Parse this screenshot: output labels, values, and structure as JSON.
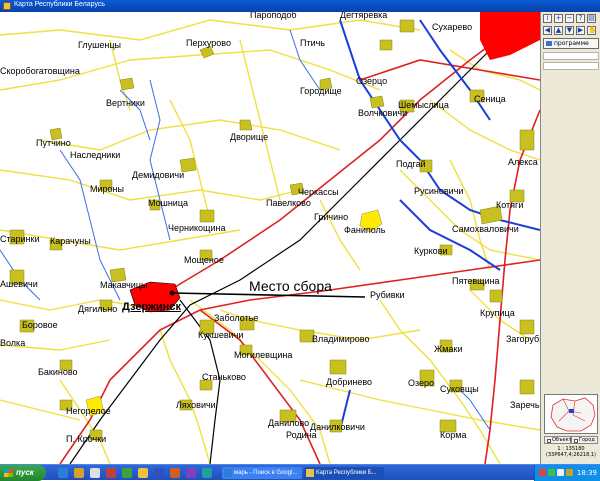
{
  "window": {
    "title": "Карта Республики Беларусь"
  },
  "map": {
    "places": [
      {
        "name": "Пароподоб",
        "key": "p1"
      },
      {
        "name": "Дегтяревка",
        "key": "p2"
      },
      {
        "name": "Сухарево",
        "key": "p3"
      },
      {
        "name": "Глушенцы",
        "key": "p4"
      },
      {
        "name": "Перхурово",
        "key": "p5"
      },
      {
        "name": "Птичь",
        "key": "p6"
      },
      {
        "name": "Скоробогатовщина",
        "key": "p7"
      },
      {
        "name": "Озерцо",
        "key": "p8"
      },
      {
        "name": "Городище",
        "key": "p9"
      },
      {
        "name": "Вертники",
        "key": "p10"
      },
      {
        "name": "Шемыслица",
        "key": "p11"
      },
      {
        "name": "Сеница",
        "key": "p12"
      },
      {
        "name": "Волчковичи",
        "key": "p13"
      },
      {
        "name": "Дворище",
        "key": "p14"
      },
      {
        "name": "Путчино",
        "key": "p15"
      },
      {
        "name": "Наследники",
        "key": "p16"
      },
      {
        "name": "Подгай",
        "key": "p17"
      },
      {
        "name": "Алекса",
        "key": "p18"
      },
      {
        "name": "Демидовичи",
        "key": "p19"
      },
      {
        "name": "Мироны",
        "key": "p20"
      },
      {
        "name": "Черкассы",
        "key": "p21"
      },
      {
        "name": "Русиновичи",
        "key": "p22"
      },
      {
        "name": "Мошница",
        "key": "p23"
      },
      {
        "name": "Павелково",
        "key": "p24"
      },
      {
        "name": "Котяги",
        "key": "p25"
      },
      {
        "name": "Гричино",
        "key": "p26"
      },
      {
        "name": "Черникощина",
        "key": "p27"
      },
      {
        "name": "Фаниполь",
        "key": "p28"
      },
      {
        "name": "Самохваловичи",
        "key": "p29"
      },
      {
        "name": "Старинки",
        "key": "p30"
      },
      {
        "name": "Карачуны",
        "key": "p31"
      },
      {
        "name": "Куркови",
        "key": "p32"
      },
      {
        "name": "Мощеное",
        "key": "p33"
      },
      {
        "name": "Ашевичи",
        "key": "p34"
      },
      {
        "name": "Макавчицы",
        "key": "p35"
      },
      {
        "name": "Пятевщина",
        "key": "p36"
      },
      {
        "name": "Рубивки",
        "key": "p37"
      },
      {
        "name": "Дягильно",
        "key": "p38"
      },
      {
        "name": "Дзержинск",
        "key": "p39"
      },
      {
        "name": "Заболотье",
        "key": "p40"
      },
      {
        "name": "Крупица",
        "key": "p41"
      },
      {
        "name": "Боровое",
        "key": "p42"
      },
      {
        "name": "Кукшевичи",
        "key": "p43"
      },
      {
        "name": "Владимирово",
        "key": "p44"
      },
      {
        "name": "Волка",
        "key": "p45"
      },
      {
        "name": "Могилевщина",
        "key": "p46"
      },
      {
        "name": "Жмаки",
        "key": "p47"
      },
      {
        "name": "Загорубье",
        "key": "p48"
      },
      {
        "name": "Бакиново",
        "key": "p49"
      },
      {
        "name": "Станьково",
        "key": "p50"
      },
      {
        "name": "Добринево",
        "key": "p51"
      },
      {
        "name": "Озеро",
        "key": "p52"
      },
      {
        "name": "Суковщы",
        "key": "p53"
      },
      {
        "name": "Негорелое",
        "key": "p54"
      },
      {
        "name": "Ляховичи",
        "key": "p55"
      },
      {
        "name": "Заречье",
        "key": "p56"
      },
      {
        "name": "Данилово",
        "key": "p57"
      },
      {
        "name": "Данилковичи",
        "key": "p58"
      },
      {
        "name": "Родина",
        "key": "p59"
      },
      {
        "name": "Корма",
        "key": "p60"
      },
      {
        "name": "П. Крочки",
        "key": "p61"
      }
    ],
    "callout": "Место сбора"
  },
  "panel": {
    "program_button": "программе",
    "minimap_tabs": [
      "Объект",
      "Город"
    ],
    "scale": "1 : 135180",
    "coords": "(33Р647,4;26218,1)"
  },
  "taskbar": {
    "start_label": "пуск",
    "tasks": [
      {
        "label": "марь - Поиск в Googl..."
      },
      {
        "label": "Карта Республики Б..."
      }
    ],
    "clock": "18:39"
  },
  "colors": {
    "city": "#ff0000",
    "village": "#c8c020",
    "road_yellow": "#f0e040",
    "road_red": "#e02020",
    "rail": "#000000",
    "river": "#1a3ed8",
    "creek": "#3b6ee0"
  }
}
